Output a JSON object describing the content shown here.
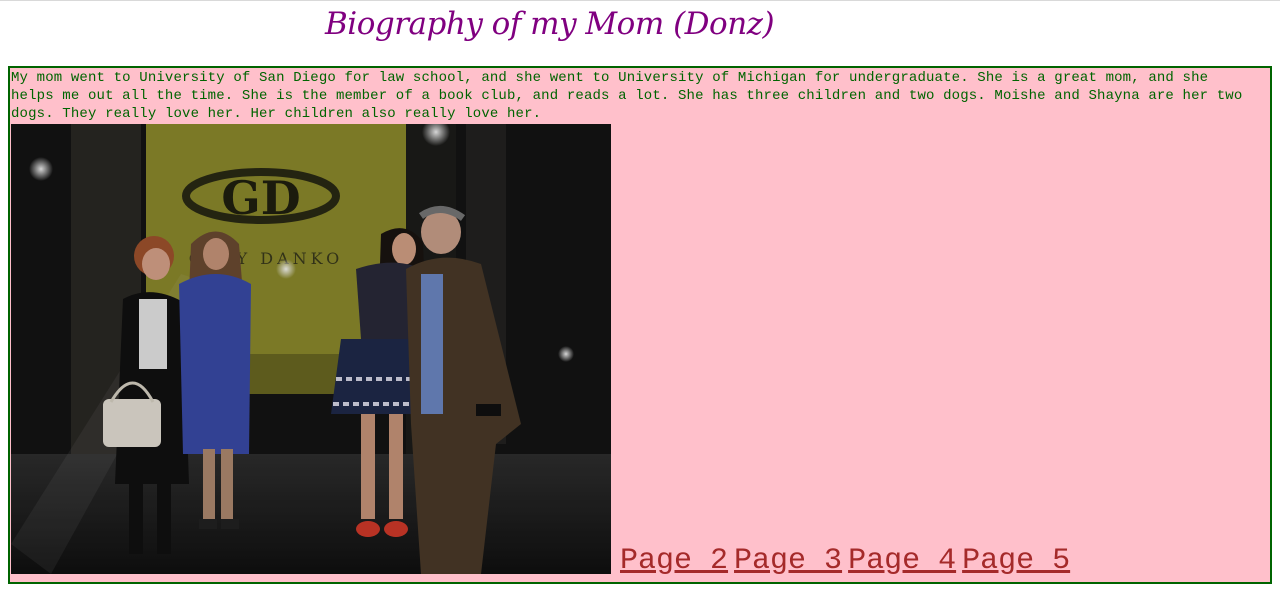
{
  "page": {
    "title": "Biography of my Mom (Donz)"
  },
  "bio": {
    "text": "My mom went to University of San Diego for law school, and she went to University of Michigan for undergraduate. She is a great mom, and she helps me out all the time. She is the member of a book club, and reads a lot. She has three children and two dogs. Moishe and Shayna are her two dogs. They really love her. Her children also really love her."
  },
  "photo": {
    "sign_text": "GARY DANKO",
    "logo_letters": "GD"
  },
  "nav": {
    "links": [
      {
        "label": "Page 2"
      },
      {
        "label": "Page 3"
      },
      {
        "label": "Page 4"
      },
      {
        "label": "Page 5"
      }
    ]
  },
  "colors": {
    "title": "#800080",
    "box_background": "#ffc0cb",
    "box_border": "#006400",
    "bio_text": "#006400",
    "link": "#a52a2a"
  }
}
